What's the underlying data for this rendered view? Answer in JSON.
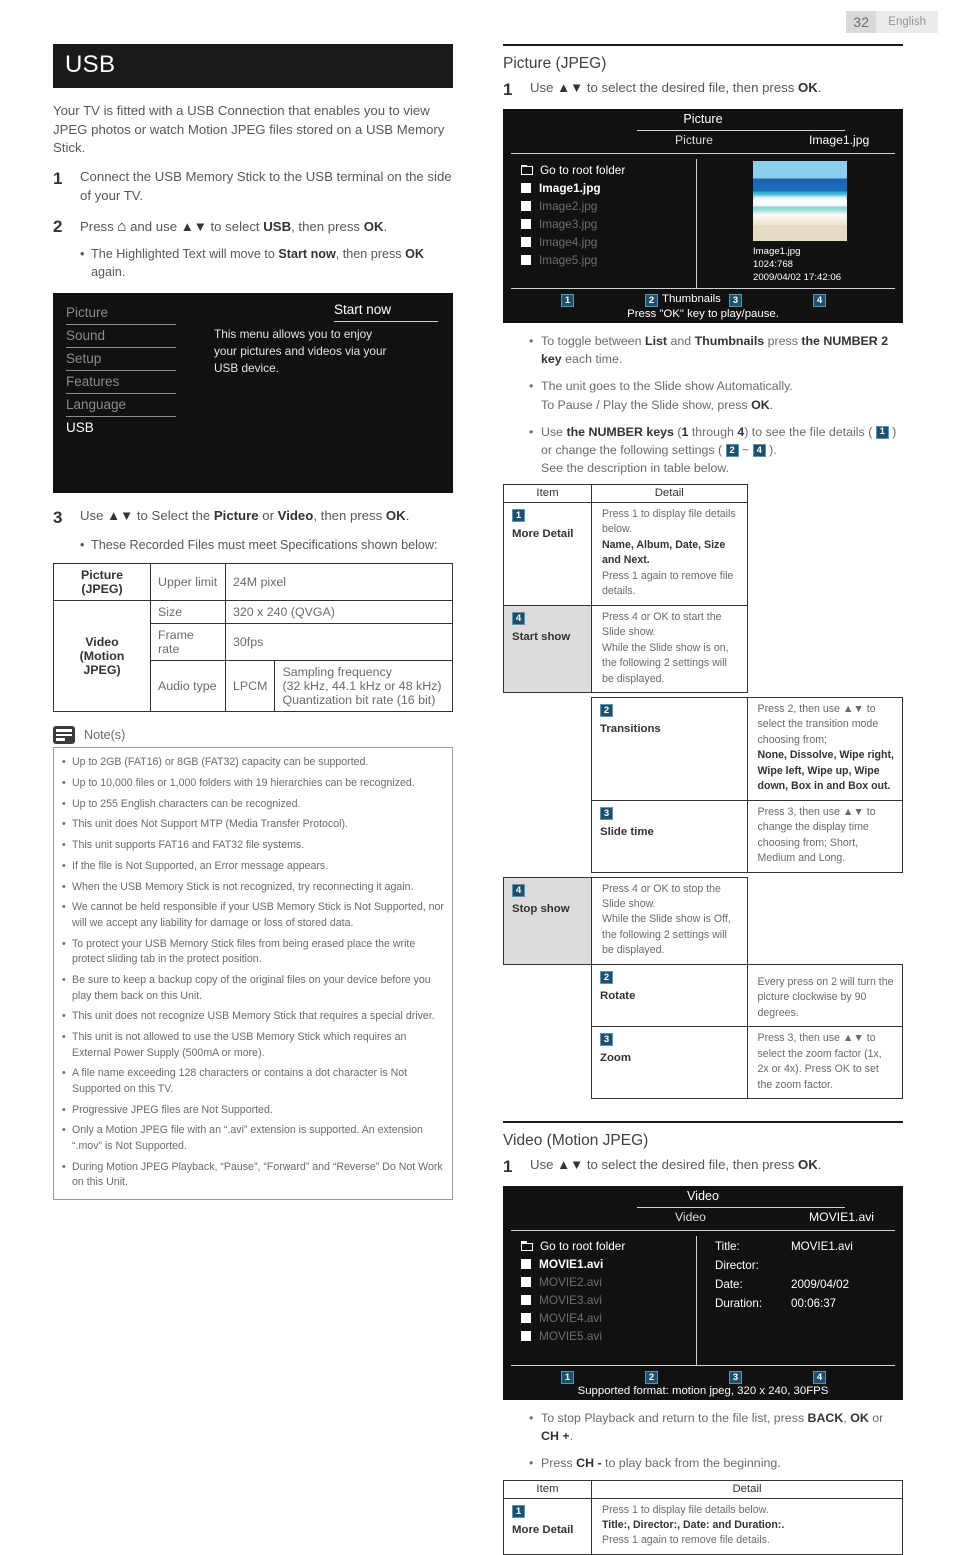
{
  "header": {
    "page_number": "32",
    "language": "English"
  },
  "left": {
    "title": "USB",
    "intro": "Your TV is fitted with a USB Connection that enables you to view JPEG photos or watch Motion JPEG files stored on a USB Memory Stick.",
    "steps": [
      {
        "num": "1",
        "text": "Connect the USB Memory Stick to the USB terminal on the side of your TV."
      },
      {
        "num": "2",
        "text": "Press ⌂ and use ▲▼ to select USB, then press OK."
      }
    ],
    "step2_sub": "The Highlighted Text will move to Start now, then press OK again.",
    "tv_menu": {
      "items": [
        "Picture",
        "Sound",
        "Setup",
        "Features",
        "Language",
        "USB"
      ],
      "active": "USB",
      "description": "This menu allows you to enjoy your pictures and videos via your USB device.",
      "start_now": "Start now"
    },
    "step3": {
      "num": "3",
      "text": "Use ▲▼ to Select the Picture or Video, then press OK."
    },
    "step3_sub": "These Recorded Files must meet Specifications shown below:",
    "spec_table": {
      "rows": [
        {
          "cat": "Picture (JPEG)",
          "label": "Upper limit",
          "value": "24M pixel"
        },
        {
          "cat": "Video\n(Motion JPEG)",
          "label": "Size",
          "value": "320 x 240 (QVGA)"
        },
        {
          "label": "Frame rate",
          "value": "30fps"
        },
        {
          "label": "Audio type",
          "codec": "LPCM",
          "value": "Sampling frequency\n(32 kHz, 44.1 kHz or 48 kHz)\nQuantization bit rate (16 bit)"
        }
      ],
      "cat1": "Picture (JPEG)",
      "cat2": "Video",
      "cat2b": "(Motion JPEG)",
      "r1_label": "Upper limit",
      "r1_value": "24M pixel",
      "r2_label": "Size",
      "r2_value": "320 x 240 (QVGA)",
      "r3_label": "Frame rate",
      "r3_value": "30fps",
      "r4_label": "Audio type",
      "r4_codec": "LPCM",
      "r4_value_1": "Sampling frequency",
      "r4_value_2": "(32 kHz, 44.1 kHz or 48 kHz)",
      "r4_value_3": "Quantization bit rate (16 bit)"
    },
    "notes_title": "Note(s)",
    "notes": [
      "Up to 2GB (FAT16) or 8GB (FAT32) capacity can be supported.",
      "Up to 10,000 files or 1,000 folders with 19 hierarchies can be recognized.",
      "Up to 255 English characters can be recognized.",
      "This unit does Not Support MTP (Media Transfer Protocol).",
      "This unit supports FAT16 and FAT32 file systems.",
      "If the file is Not Supported, an Error message appears.",
      "When the USB Memory Stick is not recognized, try reconnecting it again.",
      "We cannot be held responsible if your USB Memory Stick is Not Supported, nor will we accept any liability for damage or loss of stored data.",
      "To protect your USB Memory Stick files from being erased place the write protect sliding tab in the protect position.",
      "Be sure to keep a backup copy of the original files on your device before you play them back on this Unit.",
      "This unit does not recognize USB Memory Stick that requires a special driver.",
      "This unit is not allowed to use the USB Memory Stick which requires an External Power Supply (500mA or more).",
      "A file name exceeding 128 characters or contains a dot character is Not Supported on this TV.",
      "Progressive JPEG files are Not Supported.",
      "Only a Motion JPEG file with an “.avi” extension is supported. An extension “.mov” is Not Supported.",
      "During Motion JPEG Playback, “Pause”, “Forward” and “Reverse” Do Not Work on this Unit."
    ]
  },
  "right": {
    "picture_section": {
      "heading": "Picture (JPEG)",
      "step": {
        "num": "1",
        "text": "Use ▲▼ to select the desired file, then press OK."
      },
      "browser": {
        "title": "Picture",
        "sub_left": "Picture",
        "sub_right": "Image1.jpg",
        "root_label": "Go to root folder",
        "files": [
          "Image1.jpg",
          "Image2.jpg",
          "Image3.jpg",
          "Image4.jpg",
          "Image5.jpg"
        ],
        "selected": "Image1.jpg",
        "thumb_name": "Image1.jpg",
        "thumb_res": "1024:768",
        "thumb_date": "2009/04/02  17:42:06",
        "keys": [
          "1",
          "2",
          "3",
          "4"
        ],
        "key2_label": "Thumbnails",
        "footer_note": "Press \"OK\" key to play/pause."
      },
      "bullets": [
        "To toggle between List and Thumbnails press the NUMBER 2 key each time.",
        "The unit goes to the Slide show Automatically.\nTo Pause / Play the Slide show, press OK.",
        "Use the NUMBER keys (1 through 4) to see the file details ( 1 ) or change the following settings ( 2 ~ 4 ).\nSee the description in table below."
      ],
      "table": {
        "col_item": "Item",
        "col_detail": "Detail",
        "rows": [
          {
            "key": "1",
            "name": "More Detail",
            "shade": false,
            "detail_1": "Press 1 to display file details below.",
            "detail_2": "Name, Album, Date, Size and Next.",
            "detail_3": "Press 1 again to remove file details."
          },
          {
            "key": "4",
            "name": "Start show",
            "shade": true,
            "detail_1": "Press 4 or OK to start the Slide show.",
            "detail_2": "While the Slide show is on, the following 2 settings will be displayed.",
            "detail_3": ""
          },
          {
            "key": "2",
            "name": "Transitions",
            "shade": false,
            "indent": true,
            "detail_1": "Press 2, then use ▲▼ to select the transition mode choosing from;",
            "detail_2": "None, Dissolve, Wipe right, Wipe left, Wipe up, Wipe down, Box in and Box out.",
            "detail_3": ""
          },
          {
            "key": "3",
            "name": "Slide time",
            "shade": false,
            "indent": true,
            "detail_1": "Press 3, then use ▲▼ to change the display time choosing from; Short, Medium and Long.",
            "detail_2": "",
            "detail_3": ""
          },
          {
            "key": "4",
            "name": "Stop show",
            "shade": true,
            "detail_1": "Press 4 or OK to stop the Slide show.",
            "detail_2": "While the Slide show is Off, the following 2 settings will be displayed.",
            "detail_3": ""
          },
          {
            "key": "2",
            "name": "Rotate",
            "shade": false,
            "indent": true,
            "detail_1": "Every press on 2 will turn the picture clockwise by 90 degrees.",
            "detail_2": "",
            "detail_3": ""
          },
          {
            "key": "3",
            "name": "Zoom",
            "shade": false,
            "indent": true,
            "detail_1": "Press 3, then use ▲▼ to select the zoom factor (1x, 2x or 4x). Press OK to set the zoom factor.",
            "detail_2": "",
            "detail_3": ""
          }
        ]
      }
    },
    "video_section": {
      "heading": "Video (Motion JPEG)",
      "step": {
        "num": "1",
        "text": "Use ▲▼ to select the desired file, then press OK."
      },
      "browser": {
        "title": "Video",
        "sub_left": "Video",
        "sub_right": "MOVIE1.avi",
        "root_label": "Go to root folder",
        "files": [
          "MOVIE1.avi",
          "MOVIE2.avi",
          "MOVIE3.avi",
          "MOVIE4.avi",
          "MOVIE5.avi"
        ],
        "selected": "MOVIE1.avi",
        "meta": [
          {
            "key": "Title:",
            "value": "MOVIE1.avi"
          },
          {
            "key": "Director:",
            "value": ""
          },
          {
            "key": "Date:",
            "value": "2009/04/02"
          },
          {
            "key": "Duration:",
            "value": "00:06:37"
          }
        ],
        "keys": [
          "1",
          "2",
          "3",
          "4"
        ],
        "footer_note": "Supported format: motion jpeg, 320 x 240, 30FPS"
      },
      "bullets": [
        "To stop Playback and return to the file list, press BACK, OK or CH +.",
        "Press CH - to play back from the beginning."
      ],
      "table": {
        "col_item": "Item",
        "col_detail": "Detail",
        "rows": [
          {
            "key": "1",
            "name": "More Detail",
            "shade": false,
            "detail_1": "Press 1 to display file details below.",
            "detail_2": "Title:, Director:, Date: and Duration:.",
            "detail_3": "Press 1 again to remove file details."
          }
        ]
      }
    }
  },
  "colors": {
    "badge_bg": "#1e4f6b",
    "badge_border": "#5b93b3",
    "title_bar": "#1a1a1a",
    "shade": "#dcdcdc"
  }
}
